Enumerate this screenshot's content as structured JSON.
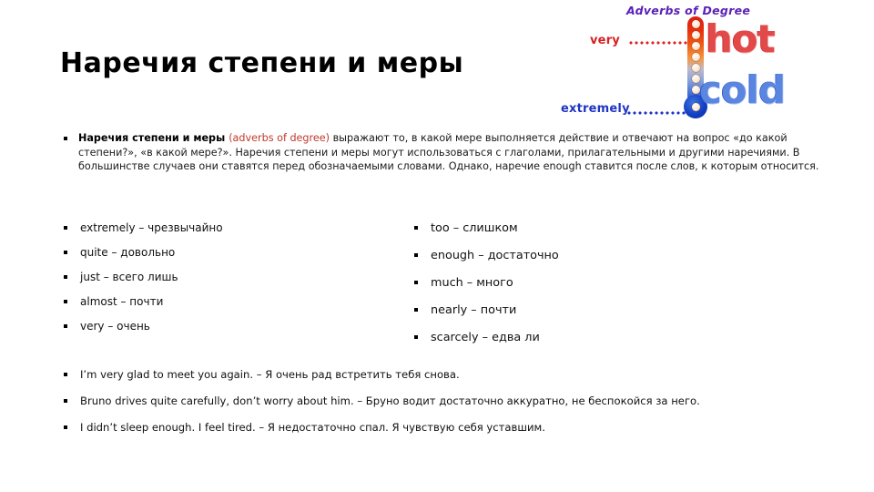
{
  "slide": {
    "title": "Наречия степени и меры"
  },
  "figure": {
    "caption": "Adverbs of Degree",
    "label_very": "very",
    "label_extremely": "extremely",
    "label_hot": "hot",
    "label_cold": "cold",
    "colors": {
      "caption": "#5b21b6",
      "hot": "#e24a4a",
      "cold": "#5b86e0",
      "very": "#d62121",
      "extremely": "#1f35c4"
    }
  },
  "intro": {
    "lead": "Наречия степени и меры",
    "en_term": "(adverbs of degree)",
    "body": " выражают то, в какой мере выполняется действие и отвечают на вопрос «до какой степени?», «в какой мере?». Наречия степени и меры могут использоваться с глаголами, прилагательными и другими наречиями. В большинстве случаев они ставятся перед обозначаемыми словами. Однако, наречие enough ставится после слов, к которым относится.",
    "accent_color": "#c0392b"
  },
  "words": {
    "left": [
      "extremely – чрезвычайно",
      "quite – довольно",
      "just – всего лишь",
      "almost – почти",
      "very – очень"
    ],
    "right": [
      "too – слишком",
      "enough – достаточно",
      "much – много",
      "nearly – почти",
      "scarcely – едва ли"
    ]
  },
  "examples": [
    "I’m very glad to meet you again. – Я очень рад встретить тебя снова.",
    "Bruno drives quite carefully, don’t worry about him. – Бруно водит достаточно аккуратно, не беспокойся за него.",
    "I didn’t sleep enough. I feel tired. – Я недостаточно спал. Я чувствую себя уставшим."
  ]
}
